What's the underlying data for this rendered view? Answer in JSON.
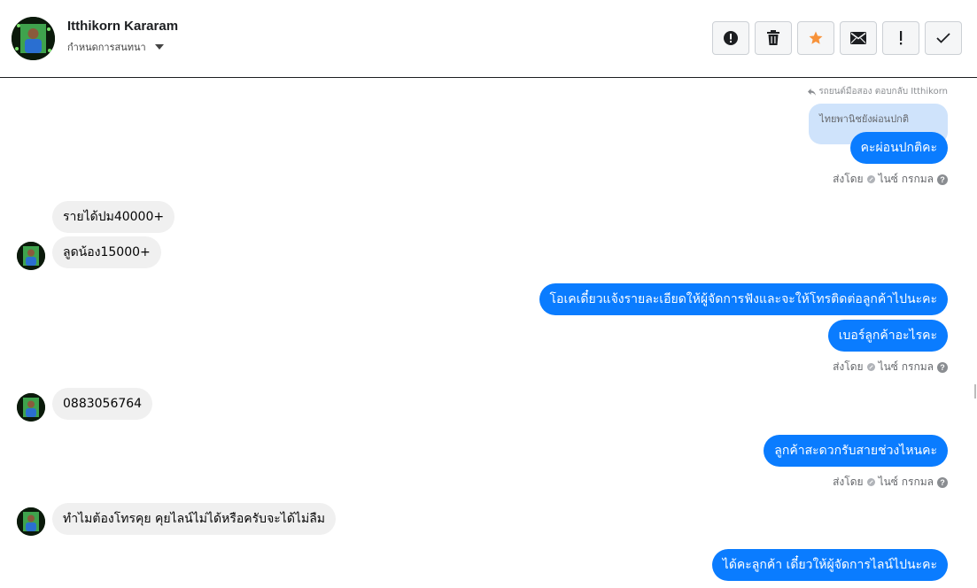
{
  "header": {
    "name": "Itthikorn Kararam",
    "assign_label": "กำหนดการสนทนา"
  },
  "toolbar": {
    "buttons": [
      {
        "icon": "alert-circle-icon",
        "label": "Mark as spam"
      },
      {
        "icon": "trash-icon",
        "label": "Delete"
      },
      {
        "icon": "star-icon",
        "label": "Star"
      },
      {
        "icon": "envelope-icon",
        "label": "Mark unread"
      },
      {
        "icon": "exclamation-icon",
        "label": "Follow up"
      },
      {
        "icon": "check-icon",
        "label": "Mark done"
      }
    ]
  },
  "colors": {
    "outgoing_bubble": "#0a7cff",
    "incoming_bubble": "#f0f0f0",
    "quoted_bubble": "#cfe3fb",
    "star": "#f7923a"
  },
  "thread": {
    "reply_note": "รถยนต์มือสอง ตอบกลับ Itthikorn",
    "quoted_text": "ไทยพานิชยังผ่อนปกติ",
    "sent_by_label": "ส่งโดย",
    "sent_by_name": "ไนซ์ กรกมล",
    "messages": [
      {
        "text": "คะผ่อนปกติคะ"
      },
      {
        "text": "รายได้ปม40000+"
      },
      {
        "text": "ลูดน้อง15000+"
      },
      {
        "text": "โอเคเดี๋ยวแจ้งรายละเอียดให้ผู้จัดการฟังและจะให้โทรติดต่อลูกค้าไปนะคะ"
      },
      {
        "text": "เบอร์ลูกค้าอะไรคะ"
      },
      {
        "text": "0883056764"
      },
      {
        "text": "ลูกค้าสะดวกรับสายช่วงไหนคะ"
      },
      {
        "text": "ทำไมต้องโทรคุย คุยไลน์ไม่ได้หรือครับจะได้ไม่ลืม"
      },
      {
        "text": "ได้คะลูกค้า เดี๋ยวให้ผู้จัดการไลน์ไปนะคะ"
      }
    ]
  }
}
